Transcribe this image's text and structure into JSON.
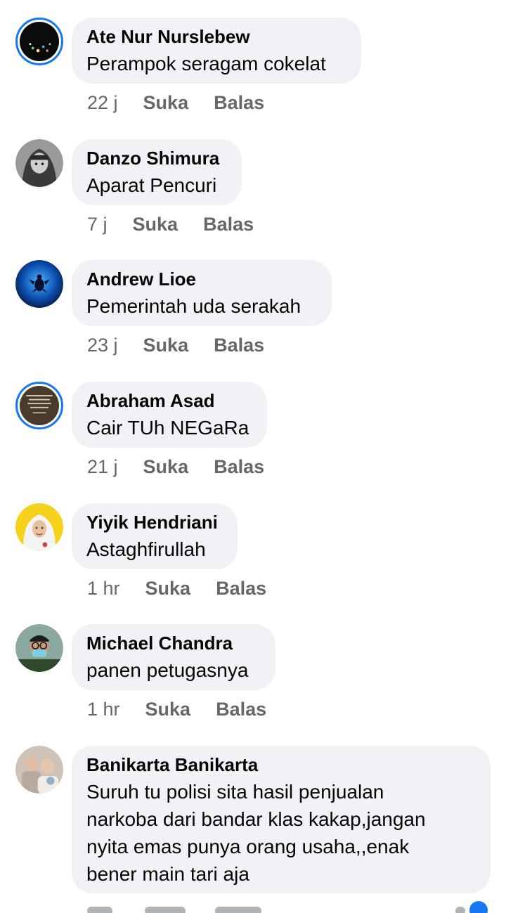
{
  "comments": [
    {
      "author": "Ate Nur Nurslebew",
      "text": "Perampok seragam cokelat",
      "time": "22 j",
      "like": "Suka",
      "reply": "Balas"
    },
    {
      "author": "Danzo Shimura",
      "text": "Aparat Pencuri",
      "time": "7 j",
      "like": "Suka",
      "reply": "Balas"
    },
    {
      "author": "Andrew Lioe",
      "text": "Pemerintah uda serakah",
      "time": "23 j",
      "like": "Suka",
      "reply": "Balas"
    },
    {
      "author": "Abraham Asad",
      "text": "Cair TUh NEGaRa",
      "time": "21 j",
      "like": "Suka",
      "reply": "Balas"
    },
    {
      "author": "Yiyik Hendriani",
      "text": "Astaghfirullah",
      "time": "1 hr",
      "like": "Suka",
      "reply": "Balas"
    },
    {
      "author": "Michael Chandra",
      "text": "panen petugasnya",
      "time": "1 hr",
      "like": "Suka",
      "reply": "Balas"
    },
    {
      "author": "Banikarta Banikarta",
      "text_lines": [
        "Suruh tu polisi sita hasil penjualan",
        "narkoba dari bandar klas kakap,jangan",
        "nyita emas punya orang usaha,,enak",
        "bener main tari aja"
      ]
    }
  ],
  "colors": {
    "bubble": "#f0f2f5",
    "meta": "#65676b",
    "ring": "#1877f2",
    "text": "#050505"
  },
  "icons": [
    "avatar-night-sky",
    "avatar-hooded-figure",
    "avatar-sea-turtle",
    "avatar-quote-image",
    "avatar-hijab-woman",
    "avatar-masked-man",
    "avatar-family-photo"
  ]
}
